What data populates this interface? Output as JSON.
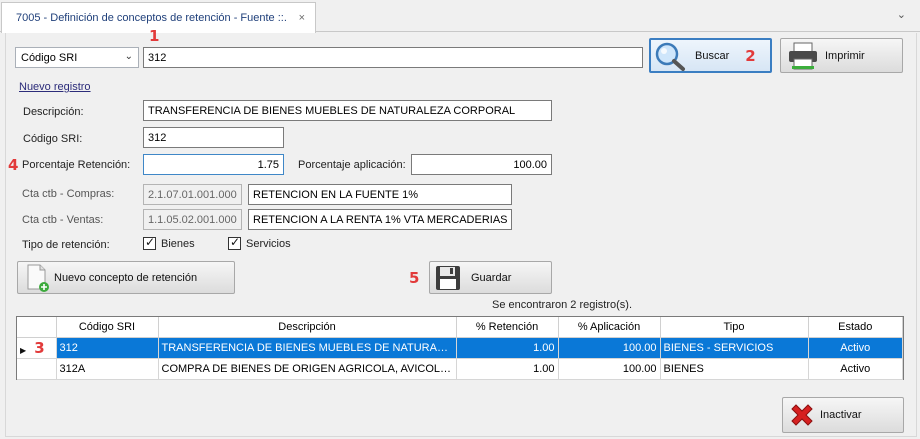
{
  "tab": {
    "title": "7005 - Definición de conceptos de retención - Fuente ::.",
    "close": "×"
  },
  "search": {
    "field_selected": "Código SRI",
    "value": "312",
    "search_button": "Buscar",
    "print_button": "Imprimir"
  },
  "form": {
    "new_record_link": "Nuevo registro",
    "description_label": "Descripción:",
    "description_value": "TRANSFERENCIA DE BIENES MUEBLES DE NATURALEZA CORPORAL",
    "code_label": "Código SRI:",
    "code_value": "312",
    "percent_label": "Porcentaje Retención:",
    "percent_value": "1.75",
    "apply_label": "Porcentaje aplicación:",
    "apply_value": "100.00",
    "purchases_label": "Cta ctb - Compras:",
    "purchases_account": "2.1.07.01.001.000",
    "purchases_desc": "RETENCION EN LA FUENTE 1%",
    "sales_label": "Cta ctb - Ventas:",
    "sales_account": "1.1.05.02.001.000",
    "sales_desc": "RETENCION A LA RENTA 1% VTA MERCADERIAS",
    "type_label": "Tipo de retención:",
    "goods_label": "Bienes",
    "goods_checked": true,
    "services_label": "Servicios",
    "services_checked": true
  },
  "actions": {
    "new_button": "Nuevo concepto de retención",
    "save_button": "Guardar",
    "deactivate_button": "Inactivar"
  },
  "results": {
    "count_text": "Se encontraron 2 registro(s).",
    "columns": [
      "Código SRI",
      "Descripción",
      "% Retención",
      "% Aplicación",
      "Tipo",
      "Estado"
    ],
    "rows": [
      {
        "code": "312",
        "desc": "TRANSFERENCIA DE BIENES MUEBLES DE NATURALEZA C...",
        "ret": "1.00",
        "apl": "100.00",
        "tipo": "BIENES - SERVICIOS",
        "estado": "Activo"
      },
      {
        "code": "312A",
        "desc": "COMPRA DE BIENES DE ORIGEN AGRICOLA, AVICOLA, PE...",
        "ret": "1.00",
        "apl": "100.00",
        "tipo": "BIENES",
        "estado": "Activo"
      }
    ]
  },
  "markers": {
    "m1": "1",
    "m2": "2",
    "m3": "3",
    "m4": "4",
    "m5": "5"
  },
  "colors": {
    "selection": "#0a78d7",
    "marker": "#e23a3a",
    "focus": "#3b7ec2"
  }
}
